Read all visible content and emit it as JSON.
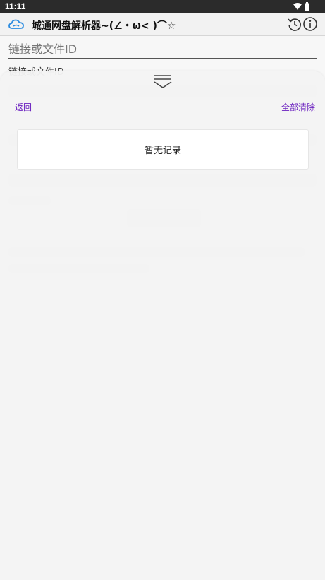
{
  "status_bar": {
    "time": "11:11",
    "icons": [
      "wifi-icon",
      "battery-icon"
    ]
  },
  "app_bar": {
    "title": "城通网盘解析器~(∠・ω< )⌒☆",
    "icons": [
      "cloud-logo-icon",
      "history-icon",
      "info-icon"
    ]
  },
  "background": {
    "input_placeholder": "链接或文件ID",
    "field_label": "链接或文件ID"
  },
  "history_sheet": {
    "back_label": "返回",
    "clear_all_label": "全部清除",
    "empty_text": "暂无记录"
  },
  "colors": {
    "accent": "#6a1fbf",
    "status_bar": "#2b2b2b",
    "sheet_bg": "#f4f4f4",
    "logo_blue": "#2a8be0"
  }
}
